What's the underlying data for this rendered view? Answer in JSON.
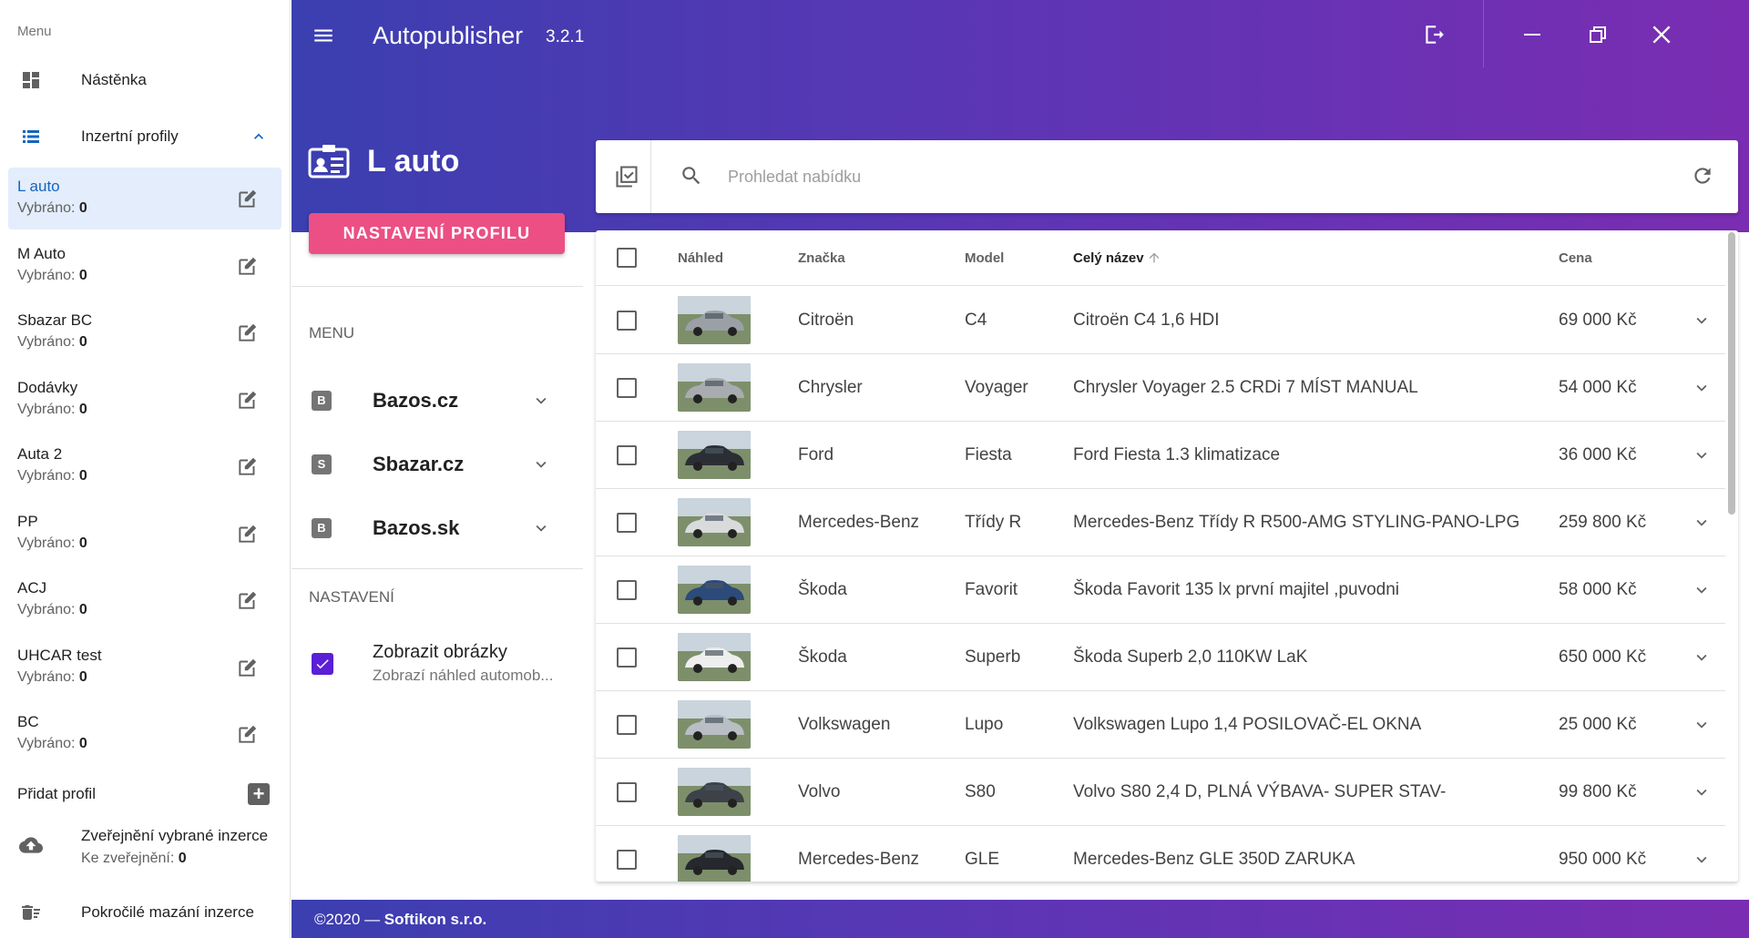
{
  "app": {
    "title": "Autopublisher",
    "version": "3.2.1",
    "header_gradient": [
      "#3b3fb0",
      "#7a2db2"
    ],
    "accent": "#ec4f84"
  },
  "drawer": {
    "caption": "Menu",
    "dashboard_label": "Nástěnka",
    "profiles_label": "Inzertní profily",
    "selected_prefix": "Vybráno:",
    "profiles": [
      {
        "name": "L auto",
        "selected": "0",
        "active": true
      },
      {
        "name": "M Auto",
        "selected": "0"
      },
      {
        "name": "Sbazar BC",
        "selected": "0"
      },
      {
        "name": "Dodávky",
        "selected": "0"
      },
      {
        "name": "Auta 2",
        "selected": "0"
      },
      {
        "name": "PP",
        "selected": "0"
      },
      {
        "name": "ACJ",
        "selected": "0"
      },
      {
        "name": "UHCAR test",
        "selected": "0"
      },
      {
        "name": "BC",
        "selected": "0"
      }
    ],
    "add_profile_label": "Přidat profil",
    "publish_label": "Zveřejnění vybrané inzerce",
    "publish_count_prefix": "Ke zveřejnění:",
    "publish_count": "0",
    "advanced_delete_label": "Pokročilé mazání inzerce"
  },
  "profile": {
    "name": "L auto",
    "settings_button": "NASTAVENÍ PROFILU"
  },
  "mid": {
    "menu_caption": "MENU",
    "portals": [
      {
        "badge": "B",
        "label": "Bazos.cz"
      },
      {
        "badge": "S",
        "label": "Sbazar.cz"
      },
      {
        "badge": "B",
        "label": "Bazos.sk"
      }
    ],
    "settings_caption": "NASTAVENÍ",
    "show_images_label": "Zobrazit obrázky",
    "show_images_desc": "Zobrazí náhled automob...",
    "show_images_checked": true
  },
  "search": {
    "placeholder": "Prohledat nabídku",
    "value": ""
  },
  "table": {
    "headers": {
      "preview": "Náhled",
      "brand": "Značka",
      "model": "Model",
      "full_name": "Celý název",
      "price": "Cena"
    },
    "sort_column": "full_name",
    "sort_direction": "ascending",
    "rows": [
      {
        "brand": "Citroën",
        "model": "C4",
        "full_name": "Citroën C4 1,6 HDI",
        "price": "69 000 Kč",
        "thumb_color": "#9aa0a6"
      },
      {
        "brand": "Chrysler",
        "model": "Voyager",
        "full_name": "Chrysler Voyager 2.5 CRDi 7 MÍST MANUAL",
        "price": "54 000 Kč",
        "thumb_color": "#a8acb0"
      },
      {
        "brand": "Ford",
        "model": "Fiesta",
        "full_name": "Ford Fiesta 1.3 klimatizace",
        "price": "36 000 Kč",
        "thumb_color": "#2b2f35"
      },
      {
        "brand": "Mercedes-Benz",
        "model": "Třídy R",
        "full_name": "Mercedes-Benz Třídy R R500-AMG STYLING-PANO-LPG",
        "price": "259 800 Kč",
        "thumb_color": "#d8dadc"
      },
      {
        "brand": "Škoda",
        "model": "Favorit",
        "full_name": "Škoda Favorit 135 lx první majitel ,puvodni",
        "price": "58 000 Kč",
        "thumb_color": "#2c4a7a"
      },
      {
        "brand": "Škoda",
        "model": "Superb",
        "full_name": "Škoda Superb 2,0 110KW LaK",
        "price": "650 000 Kč",
        "thumb_color": "#eeeeee"
      },
      {
        "brand": "Volkswagen",
        "model": "Lupo",
        "full_name": "Volkswagen Lupo 1,4 POSILOVAČ-EL OKNA",
        "price": "25 000 Kč",
        "thumb_color": "#b8bec4"
      },
      {
        "brand": "Volvo",
        "model": "S80",
        "full_name": "Volvo S80 2,4 D, PLNÁ VÝBAVA- SUPER STAV-",
        "price": "99 800 Kč",
        "thumb_color": "#3c4248"
      },
      {
        "brand": "Mercedes-Benz",
        "model": "GLE",
        "full_name": "Mercedes-Benz GLE 350D ZARUKA",
        "price": "950 000 Kč",
        "thumb_color": "#25282c"
      }
    ]
  },
  "footer": {
    "copyright": "©2020 — ",
    "company": "Softikon s.r.o."
  }
}
